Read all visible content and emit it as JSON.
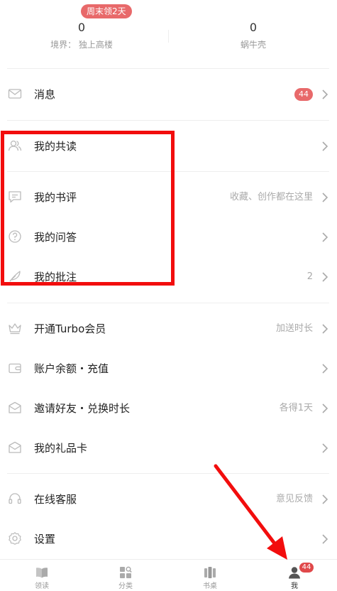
{
  "profile_stats": {
    "promo_badge": "周末领2天",
    "realm_value": "0",
    "realm_label": "境界：  独上高楼",
    "shells_value": "0",
    "shells_label": "蜗牛壳"
  },
  "menu": {
    "messages": {
      "label": "消息",
      "badge": "44"
    },
    "co_reading": {
      "label": "我的共读"
    },
    "reviews": {
      "label": "我的书评",
      "hint": "收藏、创作都在这里"
    },
    "qa": {
      "label": "我的问答"
    },
    "annotations": {
      "label": "我的批注",
      "hint": "2"
    },
    "turbo": {
      "label": "开通Turbo会员",
      "hint": "加送时长"
    },
    "balance": {
      "label": "账户余额・充值"
    },
    "invite": {
      "label": "邀请好友・兑换时长",
      "hint": "各得1天"
    },
    "gift_card": {
      "label": "我的礼品卡"
    },
    "support": {
      "label": "在线客服",
      "hint": "意见反馈"
    },
    "settings": {
      "label": "设置"
    }
  },
  "tabbar": {
    "reading": "领读",
    "category": "分类",
    "shelf": "书桌",
    "me": "我",
    "me_badge": "44"
  },
  "colors": {
    "badge": "#e8696a",
    "annotation": "#f20d0d",
    "icon": "#bbbbbb"
  }
}
